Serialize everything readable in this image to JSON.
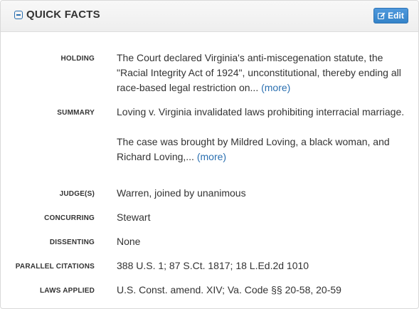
{
  "header": {
    "title": "QUICK FACTS",
    "edit_label": "Edit"
  },
  "facts": {
    "holding": {
      "label": "HOLDING",
      "text": "The Court declared Virginia's anti-miscegenation statute, the \"Racial Integrity Act of 1924\", unconstitutional, thereby ending all race-based legal restriction on...",
      "more": "(more)"
    },
    "summary": {
      "label": "SUMMARY",
      "para1": "Loving v. Virginia invalidated laws prohibiting interracial marriage.",
      "para2": "The case was brought by Mildred Loving, a black woman, and Richard Loving,...",
      "more": "(more)"
    },
    "judges": {
      "label": "JUDGE(S)",
      "value": "Warren, joined by unanimous"
    },
    "concurring": {
      "label": "CONCURRING",
      "value": "Stewart"
    },
    "dissenting": {
      "label": "DISSENTING",
      "value": "None"
    },
    "parallel_citations": {
      "label": "PARALLEL CITATIONS",
      "value": "388 U.S. 1; 87 S.Ct. 1817; 18 L.Ed.2d 1010"
    },
    "laws_applied": {
      "label": "LAWS APPLIED",
      "value": "U.S. Const. amend. XIV; Va. Code §§ 20-58, 20-59"
    }
  },
  "icons": {
    "toggle": "collapse-square-icon",
    "edit": "edit-pencil-icon"
  },
  "colors": {
    "accent": "#3483c9",
    "link": "#2a6fb0",
    "text": "#333333"
  }
}
